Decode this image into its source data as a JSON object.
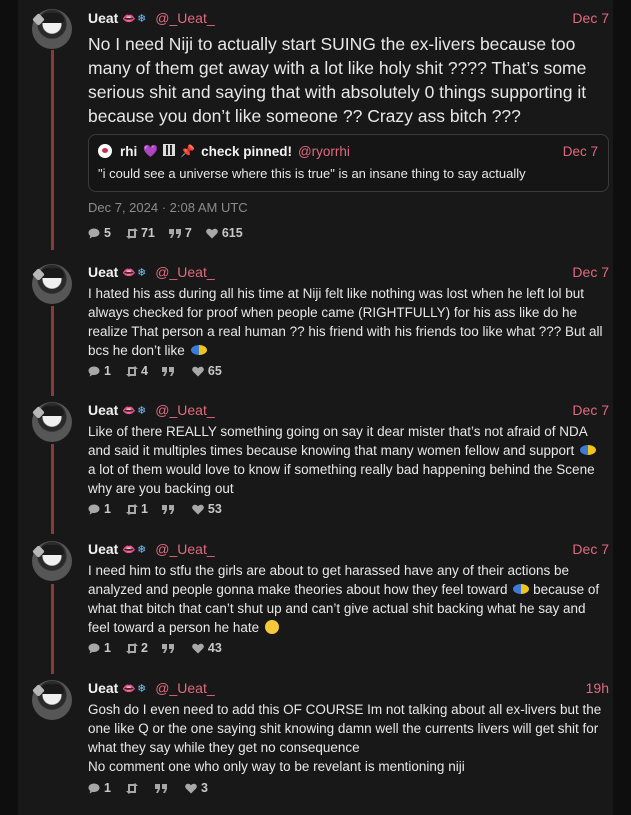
{
  "colors": {
    "accent": "#e06a7e",
    "thread_line": "#8a3a3a"
  },
  "posts": [
    {
      "name": "Ueat",
      "emoji": "💋❄️",
      "handle": "@_Ueat_",
      "date": "Dec 7",
      "text": "No I need Niji to actually start SUING the ex-livers because too many of them get away with a lot like holy shit ???? That’s some serious shit and saying that with absolutely 0 things supporting it because you don’t like someone ?? Crazy ass bitch ???",
      "quote": {
        "name": "rhi",
        "check_label": "check pinned!",
        "handle": "@ryorrhi",
        "date": "Dec 7",
        "text": "\"i could see a universe where this is true\" is an insane thing to say actually"
      },
      "timestamp": "Dec 7, 2024 · 2:08 AM UTC",
      "replies": "5",
      "retweets": "71",
      "quotes": "7",
      "likes": "615"
    },
    {
      "name": "Ueat",
      "emoji": "💋❄️",
      "handle": "@_Ueat_",
      "date": "Dec 7",
      "text": "I hated his ass during all his time at Niji felt like nothing was lost when he left lol but always checked for proof when people came (RIGHTFULLY) for his ass like do he realize That person a real human ?? his friend with his friends too like what ??? But all bcs he don’t like",
      "replies": "1",
      "retweets": "4",
      "quotes": "",
      "likes": "65"
    },
    {
      "name": "Ueat",
      "emoji": "💋❄️",
      "handle": "@_Ueat_",
      "date": "Dec 7",
      "text_a": "Like of there REALLY something going on say it dear mister that’s not afraid of NDA and said it multiples times because knowing that many women fellow and support",
      "text_b": "a lot of them would love to know if something really bad happening behind the Scene why are you backing out",
      "replies": "1",
      "retweets": "1",
      "quotes": "",
      "likes": "53"
    },
    {
      "name": "Ueat",
      "emoji": "💋❄️",
      "handle": "@_Ueat_",
      "date": "Dec 7",
      "text_a": "I need him to stfu the girls are about to get harassed have any of their actions be analyzed and people gonna make theories about how they feel toward",
      "text_b": "because of what that bitch that can’t shut up and can’t give actual shit backing what he say and feel toward a person he hate",
      "replies": "1",
      "retweets": "2",
      "quotes": "",
      "likes": "43"
    },
    {
      "name": "Ueat",
      "emoji": "💋❄️",
      "handle": "@_Ueat_",
      "date": "19h",
      "text": "Gosh do I even need to add this OF COURSE Im not talking about all ex-livers but the one like Q or the one saying shit knowing damn well the currents livers will get shit for what they say while they get no consequence",
      "text2": "No comment one who only way to be revelant is mentioning niji",
      "replies": "1",
      "retweets": "",
      "quotes": "",
      "likes": "3"
    }
  ]
}
